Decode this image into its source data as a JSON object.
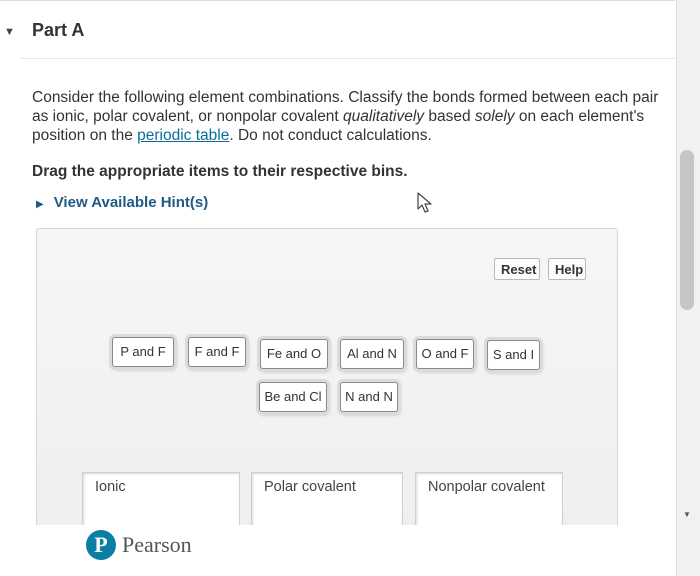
{
  "part": {
    "title": "Part A",
    "toggle_icon": "triangle-down-icon"
  },
  "question": {
    "text_before_link": "Consider the following element combinations. Classify the bonds formed between each pair as ionic, polar covalent, or nonpolar covalent ",
    "qualitatively": "qualitatively",
    "text_mid": " based ",
    "solely": "solely",
    "text_after_solely": " on each element's position on the ",
    "link": "periodic table",
    "text_end": ". Do not conduct calculations."
  },
  "instruction": "Drag the appropriate items to their respective bins.",
  "hints": {
    "label": "View Available Hint(s)",
    "icon": "triangle-right-icon"
  },
  "toolbar": {
    "reset_label": "Reset",
    "help_label": "Help"
  },
  "items": [
    {
      "label": "P and F"
    },
    {
      "label": "F and F"
    },
    {
      "label": "Fe and O"
    },
    {
      "label": "Al and N"
    },
    {
      "label": "O and F"
    },
    {
      "label": "S and I"
    },
    {
      "label": "Be and Cl"
    },
    {
      "label": "N and N"
    }
  ],
  "bins": [
    {
      "title": "Ionic"
    },
    {
      "title": "Polar covalent"
    },
    {
      "title": "Nonpolar covalent"
    }
  ],
  "branding": {
    "logo_letter": "P",
    "logo_text": "Pearson",
    "logo_color": "#0a7ea4"
  }
}
